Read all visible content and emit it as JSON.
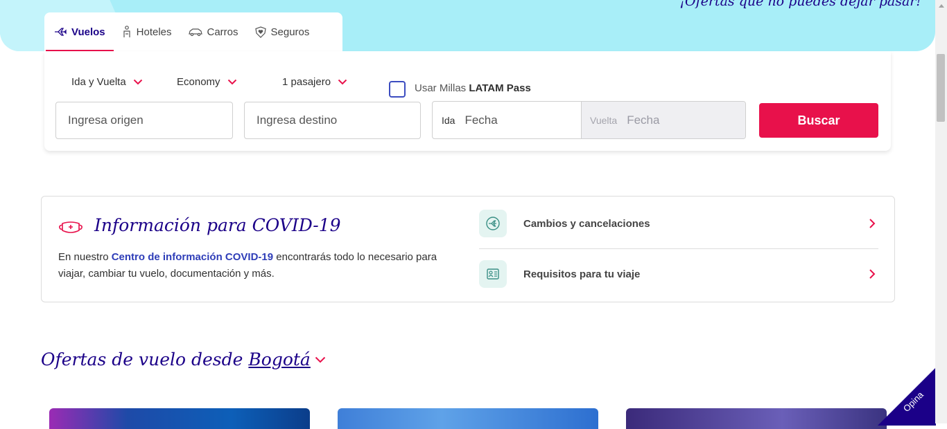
{
  "hero": {
    "tagline": "¡Ofertas que no puedes dejar pasar!"
  },
  "tabs": [
    {
      "label": "Vuelos",
      "icon": "plane-icon",
      "active": true
    },
    {
      "label": "Hoteles",
      "icon": "hotel-bellboy-icon",
      "active": false
    },
    {
      "label": "Carros",
      "icon": "car-icon",
      "active": false
    },
    {
      "label": "Seguros",
      "icon": "shield-heart-icon",
      "active": false
    }
  ],
  "search": {
    "trip_type": "Ida y Vuelta",
    "cabin": "Economy",
    "passengers": "1 pasajero",
    "millas_prefix": "Usar Millas",
    "millas_brand": "LATAM Pass",
    "origin_placeholder": "Ingresa origen",
    "destination_placeholder": "Ingresa destino",
    "ida_label": "Ida",
    "ida_value": "Fecha",
    "vuelta_label": "Vuelta",
    "vuelta_value": "Fecha",
    "button": "Buscar"
  },
  "covid": {
    "title": "Información para COVID-19",
    "text_before": "En nuestro",
    "link": "Centro de información COVID-19",
    "text_after": "encontrarás todo lo necesario para viajar, cambiar tu vuelo, documentación y más.",
    "links": [
      {
        "label": "Cambios y cancelaciones",
        "icon": "plane-change-icon"
      },
      {
        "label": "Requisitos para tu viaje",
        "icon": "id-document-icon"
      }
    ]
  },
  "ofertas": {
    "title": "Ofertas de vuelo desde",
    "city": "Bogotá"
  },
  "feedback": {
    "label": "Opina"
  },
  "colors": {
    "primary": "#1b0088",
    "accent": "#e8114b",
    "hero": "#a8eef8"
  }
}
